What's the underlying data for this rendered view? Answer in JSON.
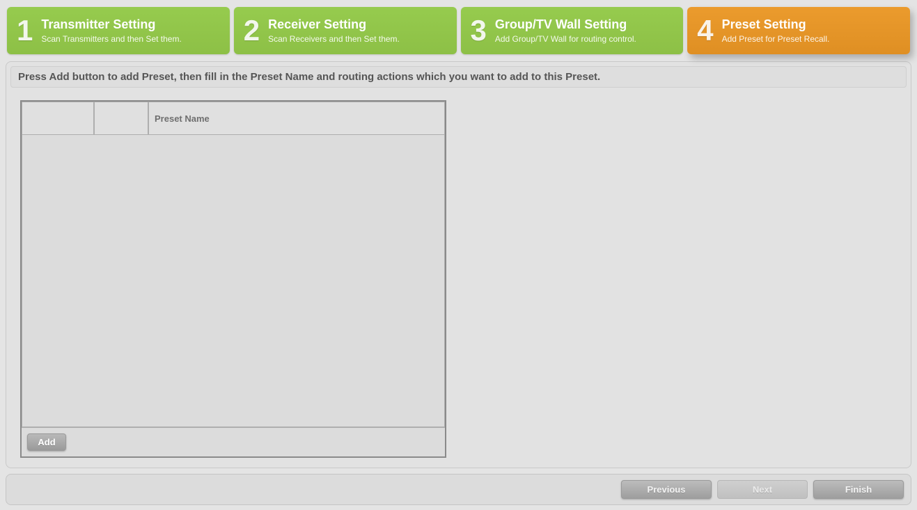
{
  "steps": [
    {
      "num": "1",
      "title": "Transmitter Setting",
      "sub": "Scan Transmitters and then Set them."
    },
    {
      "num": "2",
      "title": "Receiver Setting",
      "sub": "Scan Receivers and then Set them."
    },
    {
      "num": "3",
      "title": "Group/TV Wall Setting",
      "sub": "Add Group/TV Wall for routing control."
    },
    {
      "num": "4",
      "title": "Preset Setting",
      "sub": "Add Preset for Preset Recall."
    }
  ],
  "active_step_index": 3,
  "instruction": "Press Add button to add Preset, then fill in the Preset Name and routing actions which you want to add to this Preset.",
  "grid": {
    "col_preset_name": "Preset Name",
    "add_label": "Add"
  },
  "nav": {
    "previous": "Previous",
    "next": "Next",
    "finish": "Finish",
    "next_disabled": true
  }
}
